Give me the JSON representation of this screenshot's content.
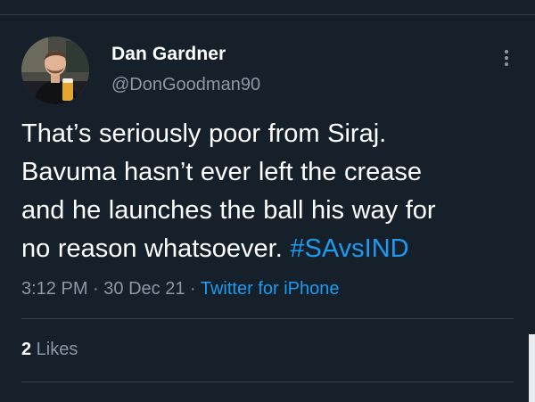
{
  "tweet": {
    "author": {
      "display_name": "Dan Gardner",
      "handle": "@DonGoodman90",
      "avatar_icon": "profile-photo"
    },
    "text_lines": [
      "That’s seriously poor from Siraj.",
      "Bavuma hasn’t ever left the crease",
      "and he launches the ball his way for",
      "no reason whatsoever. "
    ],
    "hashtag": "#SAvsIND",
    "meta": {
      "time": "3:12 PM",
      "sep1": " · ",
      "date": "30 Dec 21",
      "sep2": " · ",
      "source": "Twitter for iPhone"
    },
    "likes": {
      "count": "2",
      "label": " Likes"
    },
    "more_icon": "more-vertical-icon"
  },
  "colors": {
    "background": "#15202b",
    "text": "#ffffff",
    "secondary": "#8b98a5",
    "accent": "#1d9bf0",
    "divider": "#38444d"
  }
}
